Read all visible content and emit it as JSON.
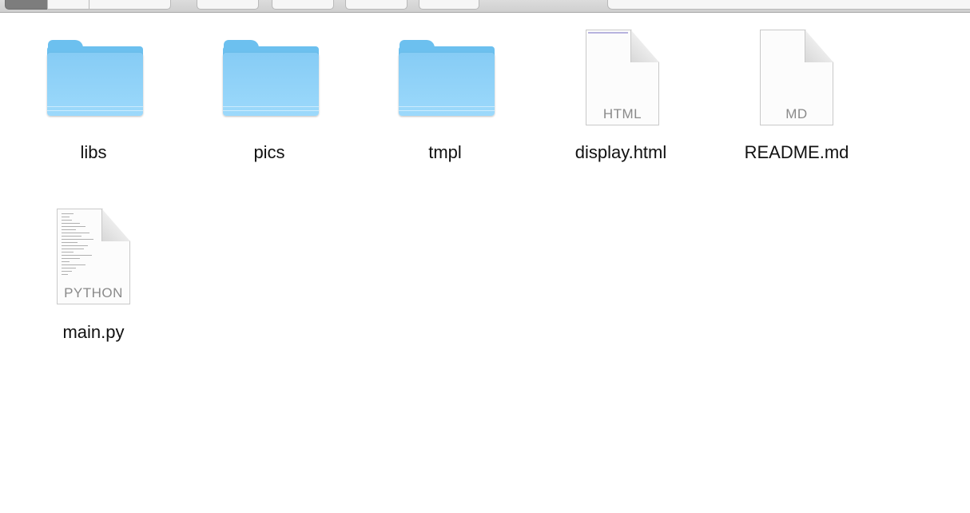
{
  "window": {
    "toolbar_visible": true
  },
  "items": [
    {
      "name": "libs",
      "kind": "folder"
    },
    {
      "name": "pics",
      "kind": "folder"
    },
    {
      "name": "tmpl",
      "kind": "folder"
    },
    {
      "name": "display.html",
      "kind": "document",
      "type_label": "HTML"
    },
    {
      "name": "README.md",
      "kind": "document",
      "type_label": "MD"
    },
    {
      "name": "main.py",
      "kind": "document",
      "type_label": "PYTHON"
    }
  ],
  "colors": {
    "folder_blue": "#86ccf5",
    "background": "#ffffff",
    "label_text": "#111111",
    "doc_type_text": "#8a8a8a"
  }
}
